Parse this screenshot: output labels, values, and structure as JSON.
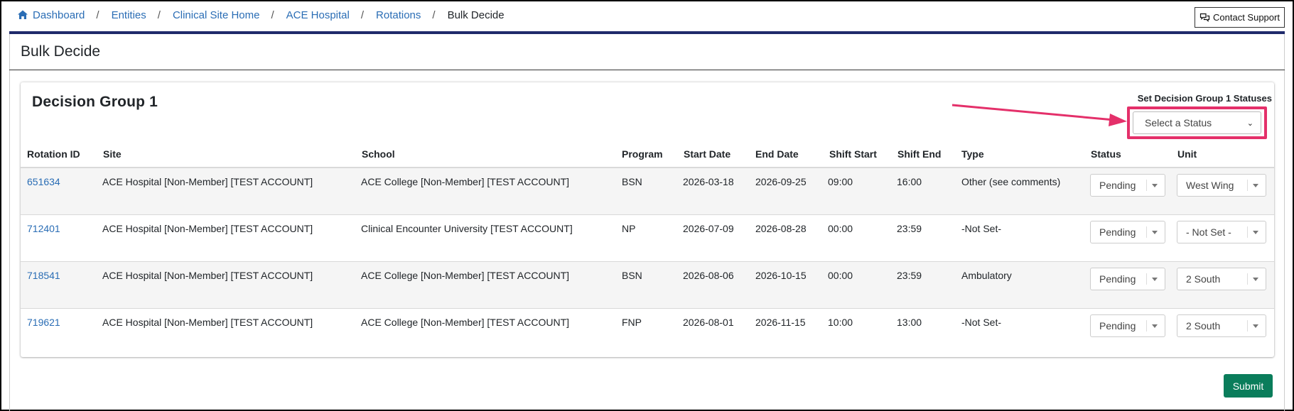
{
  "breadcrumb": {
    "items": [
      "Dashboard",
      "Entities",
      "Clinical Site Home",
      "ACE Hospital",
      "Rotations"
    ],
    "current": "Bulk Decide",
    "separator": "/"
  },
  "header": {
    "contact_label": "Contact Support"
  },
  "page": {
    "title": "Bulk Decide"
  },
  "group": {
    "title": "Decision Group 1",
    "set_label": "Set Decision Group 1 Statuses",
    "select_placeholder": "Select a Status"
  },
  "table": {
    "columns": [
      "Rotation ID",
      "Site",
      "School",
      "Program",
      "Start Date",
      "End Date",
      "Shift Start",
      "Shift End",
      "Type",
      "Status",
      "Unit"
    ],
    "rows": [
      {
        "id": "651634",
        "site": "ACE Hospital [Non-Member] [TEST ACCOUNT]",
        "school": "ACE College [Non-Member] [TEST ACCOUNT]",
        "program": "BSN",
        "start": "2026-03-18",
        "end": "2026-09-25",
        "shift_start": "09:00",
        "shift_end": "16:00",
        "type": "Other (see comments)",
        "status": "Pending",
        "unit": "West Wing"
      },
      {
        "id": "712401",
        "site": "ACE Hospital [Non-Member] [TEST ACCOUNT]",
        "school": "Clinical Encounter University [TEST ACCOUNT]",
        "program": "NP",
        "start": "2026-07-09",
        "end": "2026-08-28",
        "shift_start": "00:00",
        "shift_end": "23:59",
        "type": "-Not Set-",
        "status": "Pending",
        "unit": "- Not Set -"
      },
      {
        "id": "718541",
        "site": "ACE Hospital [Non-Member] [TEST ACCOUNT]",
        "school": "ACE College [Non-Member] [TEST ACCOUNT]",
        "program": "BSN",
        "start": "2026-08-06",
        "end": "2026-10-15",
        "shift_start": "00:00",
        "shift_end": "23:59",
        "type": "Ambulatory",
        "status": "Pending",
        "unit": "2 South"
      },
      {
        "id": "719621",
        "site": "ACE Hospital [Non-Member] [TEST ACCOUNT]",
        "school": "ACE College [Non-Member] [TEST ACCOUNT]",
        "program": "FNP",
        "start": "2026-08-01",
        "end": "2026-11-15",
        "shift_start": "10:00",
        "shift_end": "13:00",
        "type": "-Not Set-",
        "status": "Pending",
        "unit": "2 South"
      }
    ]
  },
  "footer": {
    "submit_label": "Submit"
  },
  "colors": {
    "link": "#2a6db5",
    "accent_bar": "#1f2a6b",
    "highlight": "#e4306a",
    "submit": "#0a7d5b"
  }
}
